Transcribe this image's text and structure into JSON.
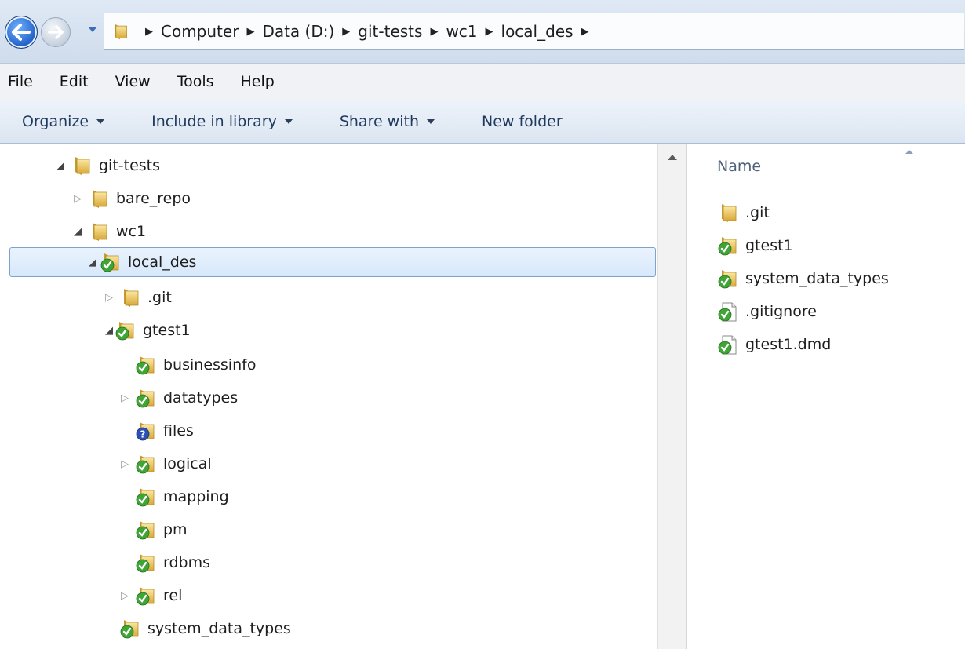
{
  "address": {
    "crumbs": [
      "Computer",
      "Data (D:)",
      "git-tests",
      "wc1",
      "local_des"
    ]
  },
  "menu": [
    "File",
    "Edit",
    "View",
    "Tools",
    "Help"
  ],
  "commands": {
    "organize": "Organize",
    "include": "Include in library",
    "share": "Share with",
    "new_folder": "New folder"
  },
  "tree": [
    {
      "label": "git-tests",
      "icon": "folder-icon"
    },
    {
      "label": "bare_repo",
      "icon": "folder-icon"
    },
    {
      "label": "wc1",
      "icon": "folder-icon"
    },
    {
      "label": "local_des",
      "icon": "folder-synced-icon"
    },
    {
      "label": ".git",
      "icon": "folder-icon"
    },
    {
      "label": "gtest1",
      "icon": "folder-synced-icon"
    },
    {
      "label": "businessinfo",
      "icon": "folder-synced-icon"
    },
    {
      "label": "datatypes",
      "icon": "folder-synced-icon"
    },
    {
      "label": "files",
      "icon": "folder-unversioned-icon"
    },
    {
      "label": "logical",
      "icon": "folder-synced-icon"
    },
    {
      "label": "mapping",
      "icon": "folder-synced-icon"
    },
    {
      "label": "pm",
      "icon": "folder-synced-icon"
    },
    {
      "label": "rdbms",
      "icon": "folder-synced-icon"
    },
    {
      "label": "rel",
      "icon": "folder-synced-icon"
    },
    {
      "label": "system_data_types",
      "icon": "folder-synced-icon"
    }
  ],
  "content": {
    "column_name": "Name",
    "files": [
      {
        "label": ".git",
        "icon": "folder-icon"
      },
      {
        "label": "gtest1",
        "icon": "folder-synced-icon"
      },
      {
        "label": "system_data_types",
        "icon": "folder-synced-icon"
      },
      {
        "label": ".gitignore",
        "icon": "file-synced-icon"
      },
      {
        "label": "gtest1.dmd",
        "icon": "file-synced-icon"
      }
    ]
  },
  "colors": {
    "folder": "#e8c35a",
    "synced_badge": "#3fa535",
    "unversioned_badge": "#2a4fb5",
    "selection_border": "#7da2ce"
  }
}
